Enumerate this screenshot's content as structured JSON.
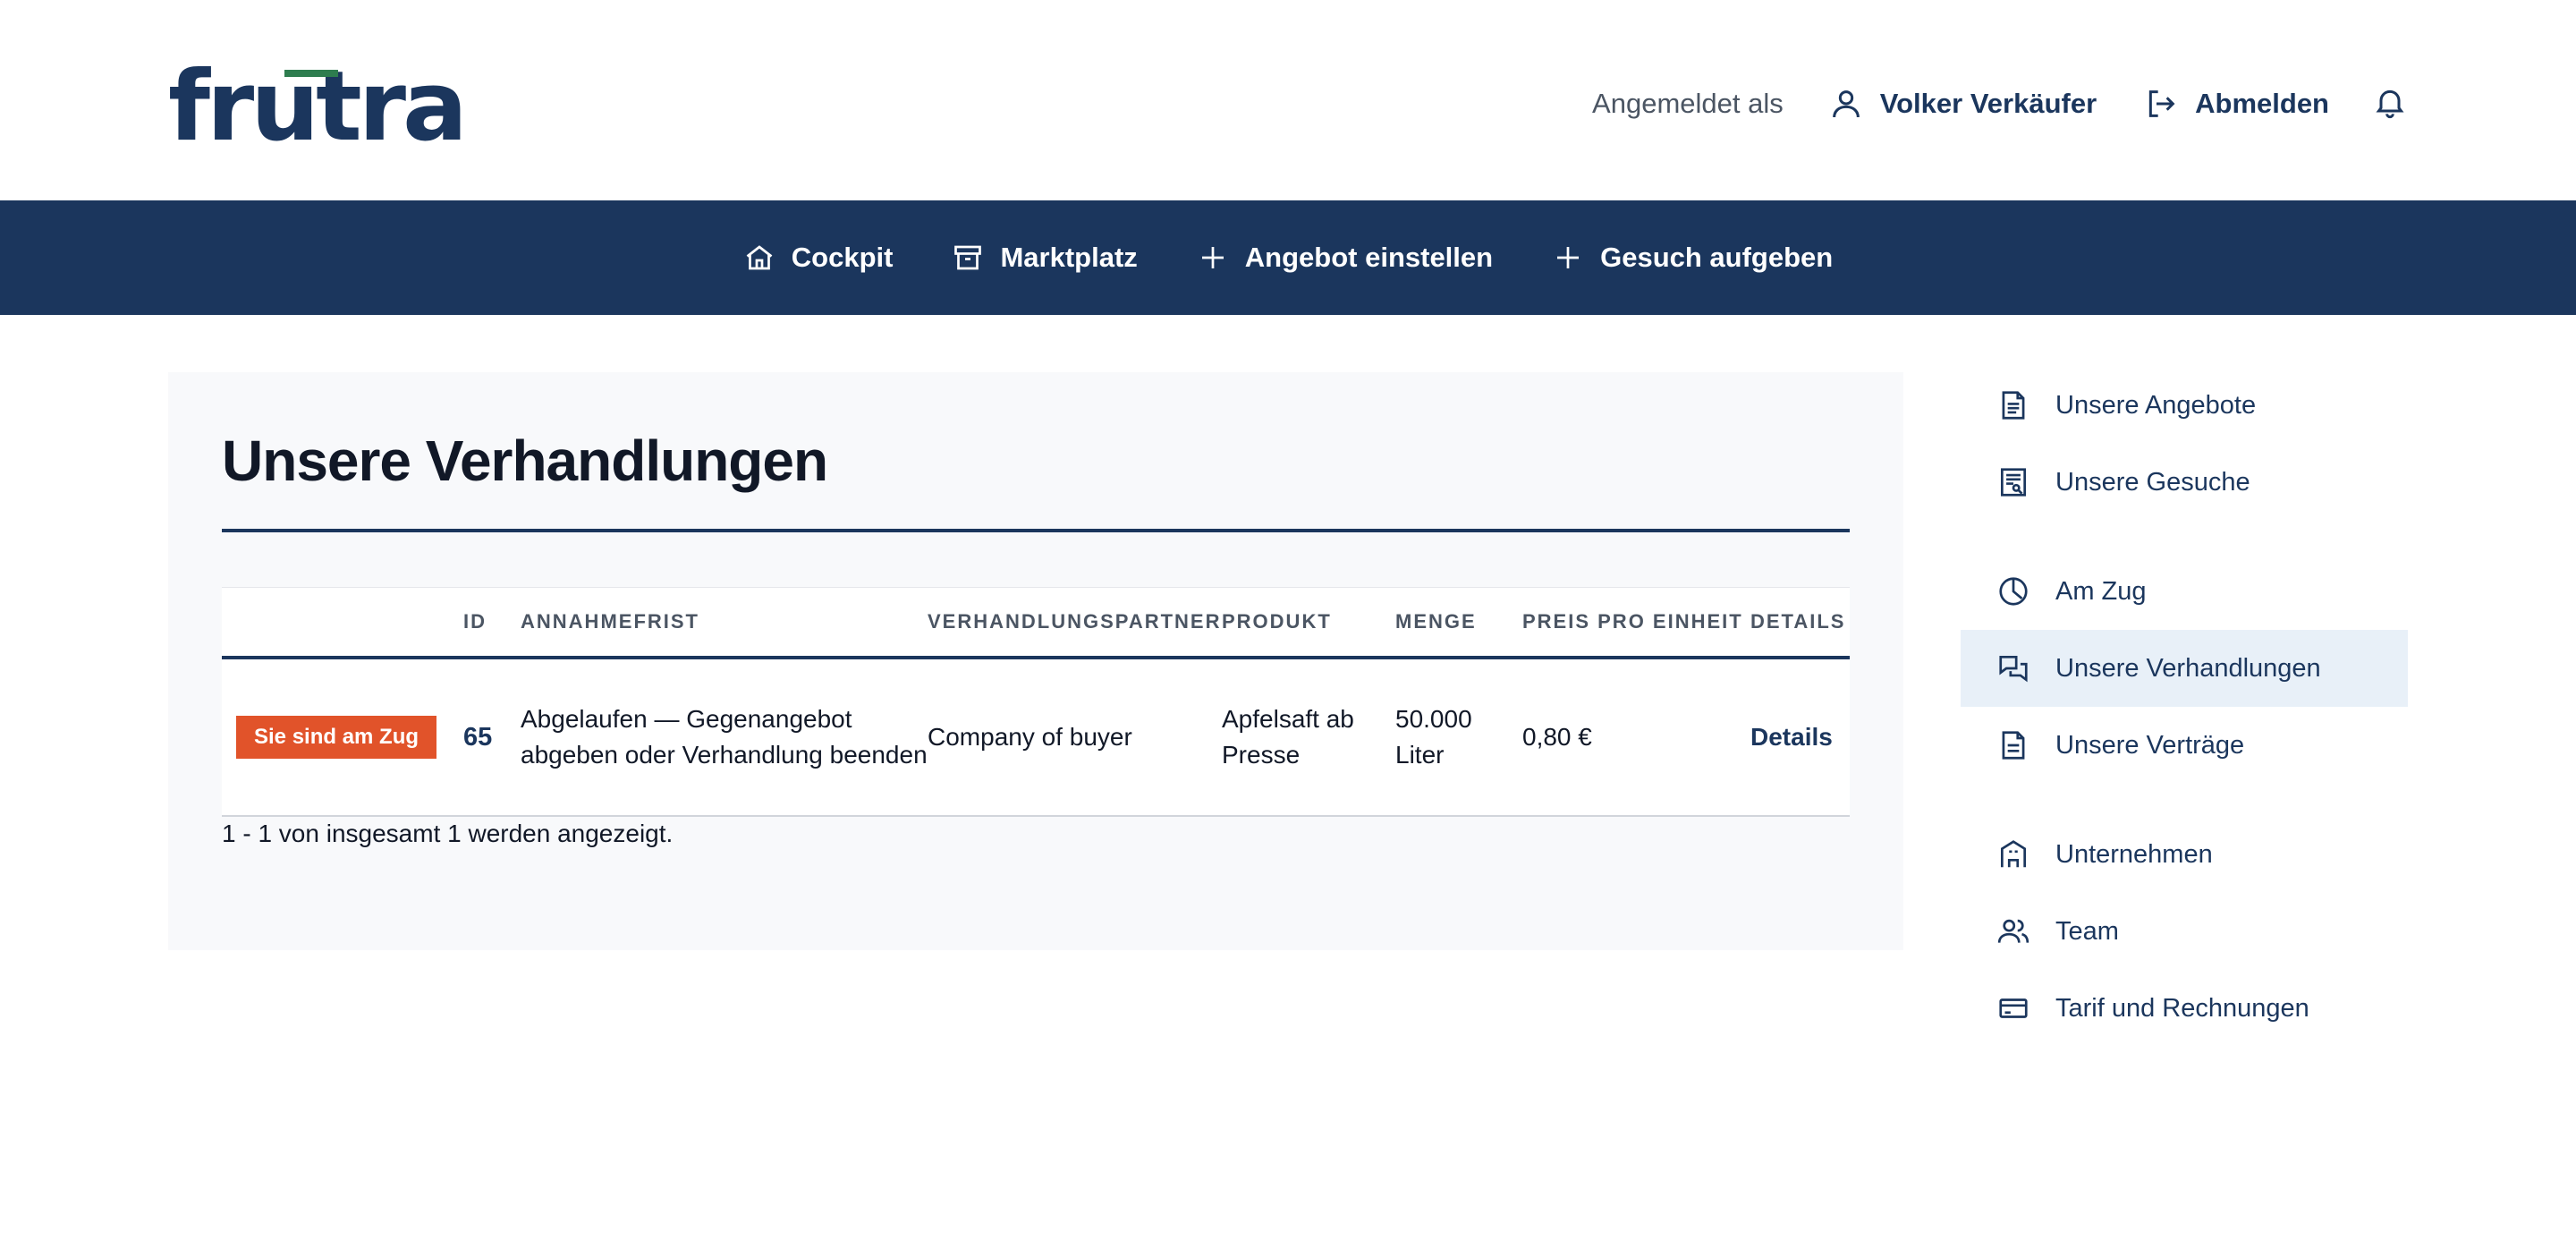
{
  "brand": {
    "logo_text": "frutra",
    "primary": "#1b365d",
    "accent_green": "#2e7d4f",
    "badge_orange": "#e1532a"
  },
  "header": {
    "logged_in_label": "Angemeldet als",
    "user_name": "Volker Verkäufer",
    "logout_label": "Abmelden",
    "icons": [
      "user-icon",
      "logout-icon",
      "bell-icon"
    ]
  },
  "nav": {
    "items": [
      {
        "label": "Cockpit",
        "icon": "home-icon"
      },
      {
        "label": "Marktplatz",
        "icon": "archive-icon"
      },
      {
        "label": "Angebot einstellen",
        "icon": "plus-icon"
      },
      {
        "label": "Gesuch aufgeben",
        "icon": "plus-icon"
      }
    ]
  },
  "main": {
    "title": "Unsere Verhandlungen",
    "table": {
      "headers": [
        "",
        "ID",
        "Annahmefrist",
        "Verhandlungspartner",
        "Produkt",
        "Menge",
        "Preis pro Einheit",
        "Details"
      ],
      "rows": [
        {
          "status": "Sie sind am Zug",
          "id": "65",
          "annahmefrist": "Abgelaufen — Gegenangebot abgeben oder Verhandlung beenden",
          "partner": "Company of buyer",
          "produkt": "Apfelsaft ab Presse",
          "menge": "50.000 Liter",
          "preis": "0,80 €",
          "details": "Details"
        }
      ]
    },
    "footer": "1 - 1 von insgesamt 1 werden angezeigt."
  },
  "sidebar": {
    "items": [
      {
        "label": "Unsere Angebote",
        "icon": "document-icon"
      },
      {
        "label": "Unsere Gesuche",
        "icon": "document-search-icon"
      },
      {
        "label": "Am Zug",
        "icon": "clock-icon"
      },
      {
        "label": "Unsere Verhandlungen",
        "icon": "chat-icon",
        "active": true
      },
      {
        "label": "Unsere Verträge",
        "icon": "contract-icon"
      },
      {
        "label": "Unternehmen",
        "icon": "building-icon"
      },
      {
        "label": "Team",
        "icon": "team-icon"
      },
      {
        "label": "Tarif und Rechnungen",
        "icon": "credit-card-icon"
      }
    ]
  }
}
